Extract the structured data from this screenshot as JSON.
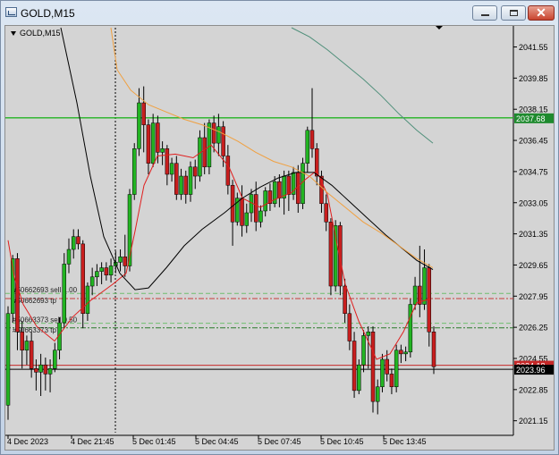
{
  "window": {
    "title": "GOLD,M15",
    "icons": {
      "app": "chart-window-icon",
      "minimize": "minimize-icon",
      "maximize": "maximize-icon",
      "close": "close-icon",
      "menu": "chart-menu-triangle-icon"
    }
  },
  "chart": {
    "header": "GOLD,M15",
    "y_axis_labels": [
      "2041.55",
      "2039.85",
      "2038.15",
      "2036.45",
      "2034.75",
      "2033.05",
      "2031.35",
      "2029.65",
      "2027.95",
      "2026.25",
      "2024.55",
      "2022.85",
      "2021.15"
    ],
    "x_axis_labels": [
      "4 Dec 2023",
      "4 Dec 21:45",
      "5 Dec 01:45",
      "5 Dec 04:45",
      "5 Dec 07:45",
      "5 Dec 10:45",
      "5 Dec 13:45"
    ],
    "price_tags": [
      {
        "text": "2037.68",
        "color": "#1e8a2e"
      },
      {
        "text": "2024.18",
        "color": "#c62828"
      },
      {
        "text": "2023.96",
        "color": "#000000"
      }
    ],
    "order_labels": [
      {
        "text": "#50662693 sell 1.00"
      },
      {
        "text": "#50662693 tp"
      },
      {
        "text": "#50663373 sell 0.50"
      },
      {
        "text": "#50663373 tp"
      }
    ],
    "colors": {
      "bull": "#22b422",
      "bear": "#c81e1e",
      "ma_fast": "#e01e1e",
      "ma_mid": "#000000",
      "ma_orange": "#f0a040",
      "ma_slow": "#4f8f7a",
      "grid": "#a0a0a0"
    }
  },
  "chart_data": {
    "type": "candlestick",
    "symbol": "GOLD",
    "timeframe": "M15",
    "ylim": [
      2020.5,
      2042.6
    ],
    "candles": [
      [
        2022.0,
        2027.0,
        2021.2,
        2027.4
      ],
      [
        2027.0,
        2030.0,
        2026.5,
        2030.2
      ],
      [
        2030.0,
        2026.0,
        2025.0,
        2030.3
      ],
      [
        2026.0,
        2025.0,
        2024.0,
        2026.6
      ],
      [
        2025.0,
        2025.5,
        2024.2,
        2025.8
      ],
      [
        2025.5,
        2024.0,
        2023.5,
        2026.0
      ],
      [
        2024.0,
        2023.8,
        2022.8,
        2024.5
      ],
      [
        2023.8,
        2024.2,
        2022.5,
        2024.8
      ],
      [
        2024.2,
        2023.7,
        2022.8,
        2024.6
      ],
      [
        2023.7,
        2024.0,
        2022.7,
        2024.5
      ],
      [
        2024.0,
        2025.0,
        2023.8,
        2025.4
      ],
      [
        2025.0,
        2026.5,
        2024.5,
        2026.8
      ],
      [
        2026.5,
        2029.7,
        2026.2,
        2030.3
      ],
      [
        2029.7,
        2030.5,
        2029.2,
        2031.1
      ],
      [
        2030.5,
        2031.2,
        2030.0,
        2031.6
      ],
      [
        2031.2,
        2030.8,
        2030.5,
        2031.6
      ],
      [
        2030.8,
        2027.0,
        2026.2,
        2031.0
      ],
      [
        2027.0,
        2028.5,
        2026.6,
        2028.7
      ],
      [
        2028.5,
        2029.0,
        2028.0,
        2029.5
      ],
      [
        2029.0,
        2029.3,
        2028.5,
        2029.7
      ],
      [
        2029.3,
        2029.5,
        2028.6,
        2029.8
      ],
      [
        2029.5,
        2029.1,
        2028.8,
        2029.8
      ],
      [
        2029.1,
        2029.6,
        2028.7,
        2030.0
      ],
      [
        2029.6,
        2029.8,
        2029.2,
        2030.4
      ],
      [
        2029.8,
        2030.1,
        2029.3,
        2030.5
      ],
      [
        2030.1,
        2029.6,
        2029.0,
        2031.3
      ],
      [
        2029.6,
        2033.5,
        2029.3,
        2033.8
      ],
      [
        2033.5,
        2036.0,
        2033.2,
        2036.3
      ],
      [
        2036.0,
        2038.5,
        2035.6,
        2039.3
      ],
      [
        2038.5,
        2037.3,
        2035.8,
        2039.4
      ],
      [
        2037.3,
        2035.2,
        2034.6,
        2037.6
      ],
      [
        2035.2,
        2037.4,
        2035.0,
        2037.9
      ],
      [
        2037.4,
        2035.8,
        2035.2,
        2037.8
      ],
      [
        2035.8,
        2036.0,
        2035.1,
        2036.4
      ],
      [
        2036.0,
        2034.6,
        2034.0,
        2036.2
      ],
      [
        2034.6,
        2035.2,
        2034.2,
        2035.5
      ],
      [
        2035.2,
        2033.5,
        2033.2,
        2035.6
      ],
      [
        2033.5,
        2034.5,
        2033.2,
        2034.9
      ],
      [
        2034.5,
        2033.5,
        2033.0,
        2034.8
      ],
      [
        2033.5,
        2035.0,
        2033.1,
        2035.3
      ],
      [
        2035.0,
        2034.5,
        2033.8,
        2035.4
      ],
      [
        2034.5,
        2036.6,
        2034.2,
        2037.0
      ],
      [
        2036.6,
        2035.0,
        2034.6,
        2037.4
      ],
      [
        2035.0,
        2037.4,
        2034.6,
        2037.6
      ],
      [
        2037.4,
        2036.3,
        2035.8,
        2037.8
      ],
      [
        2036.3,
        2037.2,
        2035.6,
        2037.9
      ],
      [
        2037.2,
        2035.6,
        2035.0,
        2037.5
      ],
      [
        2035.6,
        2034.0,
        2033.5,
        2036.2
      ],
      [
        2034.0,
        2032.0,
        2030.7,
        2034.3
      ],
      [
        2032.0,
        2033.3,
        2031.8,
        2033.6
      ],
      [
        2033.3,
        2031.8,
        2031.2,
        2034.0
      ],
      [
        2031.8,
        2032.5,
        2031.4,
        2033.0
      ],
      [
        2032.5,
        2033.5,
        2032.0,
        2033.8
      ],
      [
        2033.5,
        2032.0,
        2031.5,
        2034.2
      ],
      [
        2032.0,
        2032.6,
        2031.7,
        2032.9
      ],
      [
        2032.6,
        2033.7,
        2032.3,
        2033.9
      ],
      [
        2033.7,
        2033.0,
        2032.6,
        2034.1
      ],
      [
        2033.0,
        2034.2,
        2032.8,
        2034.5
      ],
      [
        2034.2,
        2033.3,
        2032.8,
        2034.6
      ],
      [
        2033.3,
        2034.5,
        2032.4,
        2034.8
      ],
      [
        2034.5,
        2033.5,
        2032.6,
        2034.8
      ],
      [
        2033.5,
        2034.7,
        2033.2,
        2035.0
      ],
      [
        2034.7,
        2033.0,
        2032.5,
        2035.1
      ],
      [
        2033.0,
        2035.2,
        2032.7,
        2035.5
      ],
      [
        2035.2,
        2037.0,
        2034.7,
        2037.2
      ],
      [
        2037.0,
        2036.0,
        2035.5,
        2039.3
      ],
      [
        2036.0,
        2034.5,
        2034.0,
        2036.3
      ],
      [
        2034.5,
        2033.0,
        2032.5,
        2034.8
      ],
      [
        2033.0,
        2032.0,
        2031.5,
        2033.5
      ],
      [
        2032.0,
        2028.5,
        2028.0,
        2032.2
      ],
      [
        2028.5,
        2031.8,
        2028.2,
        2032.1
      ],
      [
        2031.8,
        2028.5,
        2028.0,
        2032.0
      ],
      [
        2028.5,
        2027.0,
        2026.5,
        2028.9
      ],
      [
        2027.0,
        2025.5,
        2025.0,
        2027.5
      ],
      [
        2025.5,
        2022.8,
        2022.4,
        2026.0
      ],
      [
        2022.8,
        2024.2,
        2022.6,
        2024.5
      ],
      [
        2024.2,
        2025.8,
        2023.8,
        2026.1
      ],
      [
        2025.8,
        2026.0,
        2024.0,
        2026.3
      ],
      [
        2026.0,
        2022.2,
        2021.6,
        2026.3
      ],
      [
        2022.2,
        2023.0,
        2021.5,
        2023.4
      ],
      [
        2023.0,
        2024.5,
        2022.7,
        2024.8
      ],
      [
        2024.5,
        2023.7,
        2023.3,
        2025.0
      ],
      [
        2023.7,
        2023.0,
        2022.6,
        2024.0
      ],
      [
        2023.0,
        2025.0,
        2022.7,
        2025.3
      ],
      [
        2025.0,
        2024.8,
        2024.3,
        2025.3
      ],
      [
        2024.8,
        2024.9,
        2024.4,
        2025.2
      ],
      [
        2024.9,
        2027.5,
        2024.6,
        2027.8
      ],
      [
        2027.5,
        2028.5,
        2027.2,
        2029.0
      ],
      [
        2028.5,
        2027.5,
        2026.8,
        2030.7
      ],
      [
        2027.5,
        2029.5,
        2027.2,
        2030.5
      ],
      [
        2029.5,
        2026.0,
        2025.2,
        2029.7
      ],
      [
        2026.0,
        2024.1,
        2023.7,
        2026.3
      ]
    ]
  }
}
